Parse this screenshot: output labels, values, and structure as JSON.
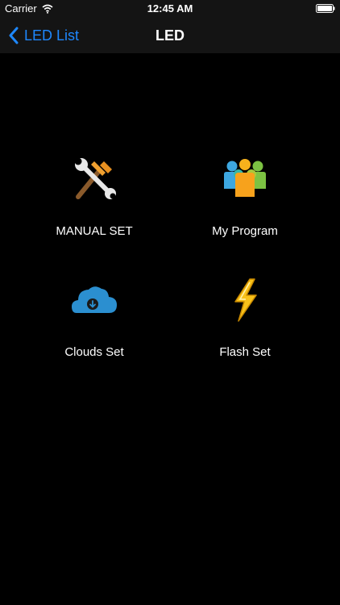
{
  "status_bar": {
    "carrier": "Carrier",
    "time": "12:45 AM"
  },
  "nav": {
    "back_label": "LED List",
    "title": "LED"
  },
  "menu": {
    "items": [
      {
        "label": "MANUAL SET",
        "icon": "tools-icon"
      },
      {
        "label": "My Program",
        "icon": "people-icon"
      },
      {
        "label": "Clouds Set",
        "icon": "cloud-download-icon"
      },
      {
        "label": "Flash Set",
        "icon": "lightning-icon"
      }
    ]
  },
  "colors": {
    "background": "#000000",
    "bar_background": "#141414",
    "accent": "#1e88ff"
  }
}
